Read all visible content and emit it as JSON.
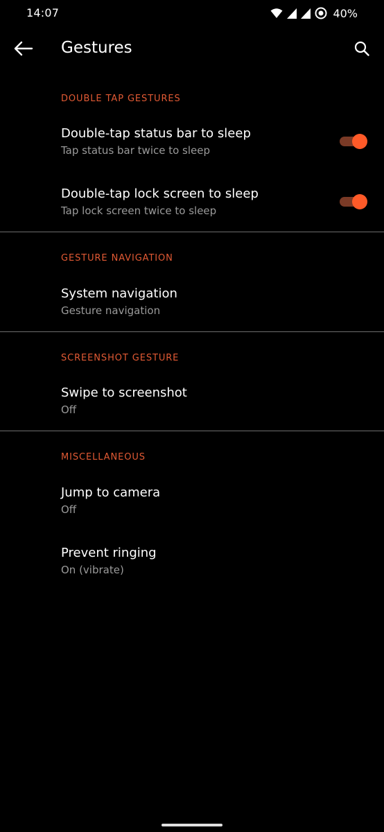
{
  "status_bar": {
    "time": "14:07",
    "battery": "40%",
    "icons": [
      "wifi-icon",
      "signal-icon",
      "signal-icon",
      "data-saver-icon"
    ]
  },
  "app_bar": {
    "title": "Gestures",
    "back_icon": "arrow-back-icon",
    "search_icon": "search-icon"
  },
  "sections": [
    {
      "header": "DOUBLE TAP GESTURES",
      "items": [
        {
          "title": "Double-tap status bar to sleep",
          "summary": "Tap status bar twice to sleep",
          "toggle": true
        },
        {
          "title": "Double-tap lock screen to sleep",
          "summary": "Tap lock screen twice to sleep",
          "toggle": true
        }
      ]
    },
    {
      "header": "GESTURE NAVIGATION",
      "items": [
        {
          "title": "System navigation",
          "summary": "Gesture navigation"
        }
      ]
    },
    {
      "header": "SCREENSHOT GESTURE",
      "items": [
        {
          "title": "Swipe to screenshot",
          "summary": "Off"
        }
      ]
    },
    {
      "header": "MISCELLANEOUS",
      "items": [
        {
          "title": "Jump to camera",
          "summary": "Off"
        },
        {
          "title": "Prevent ringing",
          "summary": "On (vibrate)"
        }
      ]
    }
  ],
  "colors": {
    "background": "#000000",
    "accent": "#e25a34",
    "toggle_thumb": "#ff5a28",
    "toggle_track": "#7a3a26",
    "summary_text": "#9a9a9a"
  }
}
